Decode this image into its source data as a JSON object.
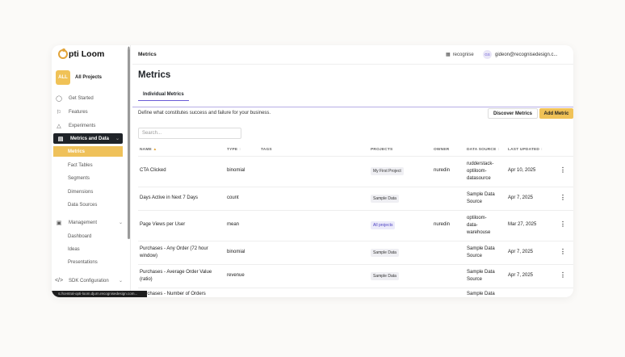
{
  "app": {
    "logo": "pti Loom"
  },
  "project": {
    "badge": "ALL",
    "label": "All Projects"
  },
  "sidebar": {
    "items": [
      {
        "label": "Get Started",
        "icon": "lightbulb-icon"
      },
      {
        "label": "Features",
        "icon": "flag-icon"
      },
      {
        "label": "Experiments",
        "icon": "flask-icon"
      },
      {
        "label": "Metrics and Data",
        "icon": "database-icon"
      },
      {
        "label": "Metrics"
      },
      {
        "label": "Fact Tables"
      },
      {
        "label": "Segments"
      },
      {
        "label": "Dimensions"
      },
      {
        "label": "Data Sources"
      },
      {
        "label": "Management",
        "icon": "clipboard-icon"
      },
      {
        "label": "Dashboard"
      },
      {
        "label": "Ideas"
      },
      {
        "label": "Presentations"
      },
      {
        "label": "SDK Configuration",
        "icon": "code-icon"
      }
    ]
  },
  "statusbar": {
    "url": "s://central-opti-loom.djurn.recognisedesign.com..."
  },
  "topbar": {
    "title": "Metrics",
    "org": "recognise",
    "avatar": "GS",
    "email": "gideon@recognisedesign.c..."
  },
  "page": {
    "title": "Metrics",
    "tab": "Individual Metrics",
    "description": "Define what constitutes success and failure for your business.",
    "discover_label": "Discover Metrics",
    "add_label": "Add Metric",
    "search_placeholder": "Search..."
  },
  "table": {
    "headers": {
      "name": "NAME",
      "type": "TYPE",
      "tags": "TAGS",
      "projects": "PROJECTS",
      "owner": "OWNER",
      "datasource": "DATA SOURCE",
      "updated": "LAST UPDATED"
    },
    "rows": [
      {
        "name": "CTA Clicked",
        "type": "binomial",
        "project": "My First Project",
        "owner": "nuredin",
        "ds": [
          "rudderstack-",
          "optiloom-",
          "datasource"
        ],
        "updated": "Apr 10, 2025"
      },
      {
        "name": "Days Active in Next 7 Days",
        "type": "count",
        "project": "Sample Data",
        "owner": "",
        "ds": [
          "Sample Data",
          "Source"
        ],
        "updated": "Apr 7, 2025"
      },
      {
        "name": "Page Views per User",
        "type": "mean",
        "project": "All projects",
        "owner": "nuredin",
        "ds": [
          "optiloom-",
          "data-",
          "warehouse"
        ],
        "updated": "Mar 27, 2025"
      },
      {
        "name": [
          "Purchases - Any Order (72 hour",
          "window)"
        ],
        "type": "binomial",
        "project": "Sample Data",
        "owner": "",
        "ds": [
          "Sample Data",
          "Source"
        ],
        "updated": "Apr 7, 2025"
      },
      {
        "name": [
          "Purchases - Average Order Value",
          "(ratio)"
        ],
        "type": "revenue",
        "project": "Sample Data",
        "owner": "",
        "ds": [
          "Sample Data",
          "Source"
        ],
        "updated": "Apr 7, 2025"
      },
      {
        "name": "Purchases - Number of Orders",
        "type": "",
        "project": "",
        "owner": "",
        "ds": [
          "Sample Data"
        ],
        "updated": ""
      }
    ]
  }
}
